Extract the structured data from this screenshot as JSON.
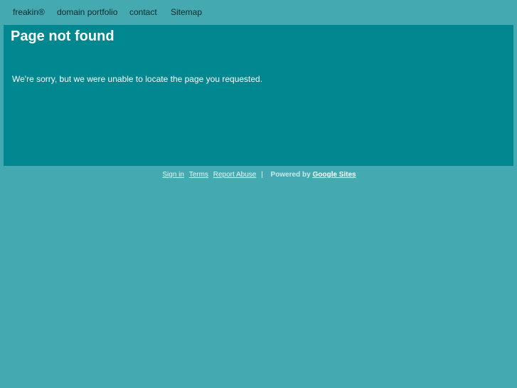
{
  "nav": {
    "items": [
      {
        "label": "freakin®"
      },
      {
        "label": "domain portfolio"
      },
      {
        "label": "contact"
      },
      {
        "label": "Sitemap"
      }
    ]
  },
  "main": {
    "title": "Page not found",
    "message": "We're sorry, but we were unable to locate the page you requested."
  },
  "footer": {
    "sign_in": "Sign in",
    "terms": "Terms",
    "report_abuse": "Report Abuse",
    "separator": "|",
    "powered_by": "Powered by",
    "google_sites": "Google Sites"
  }
}
